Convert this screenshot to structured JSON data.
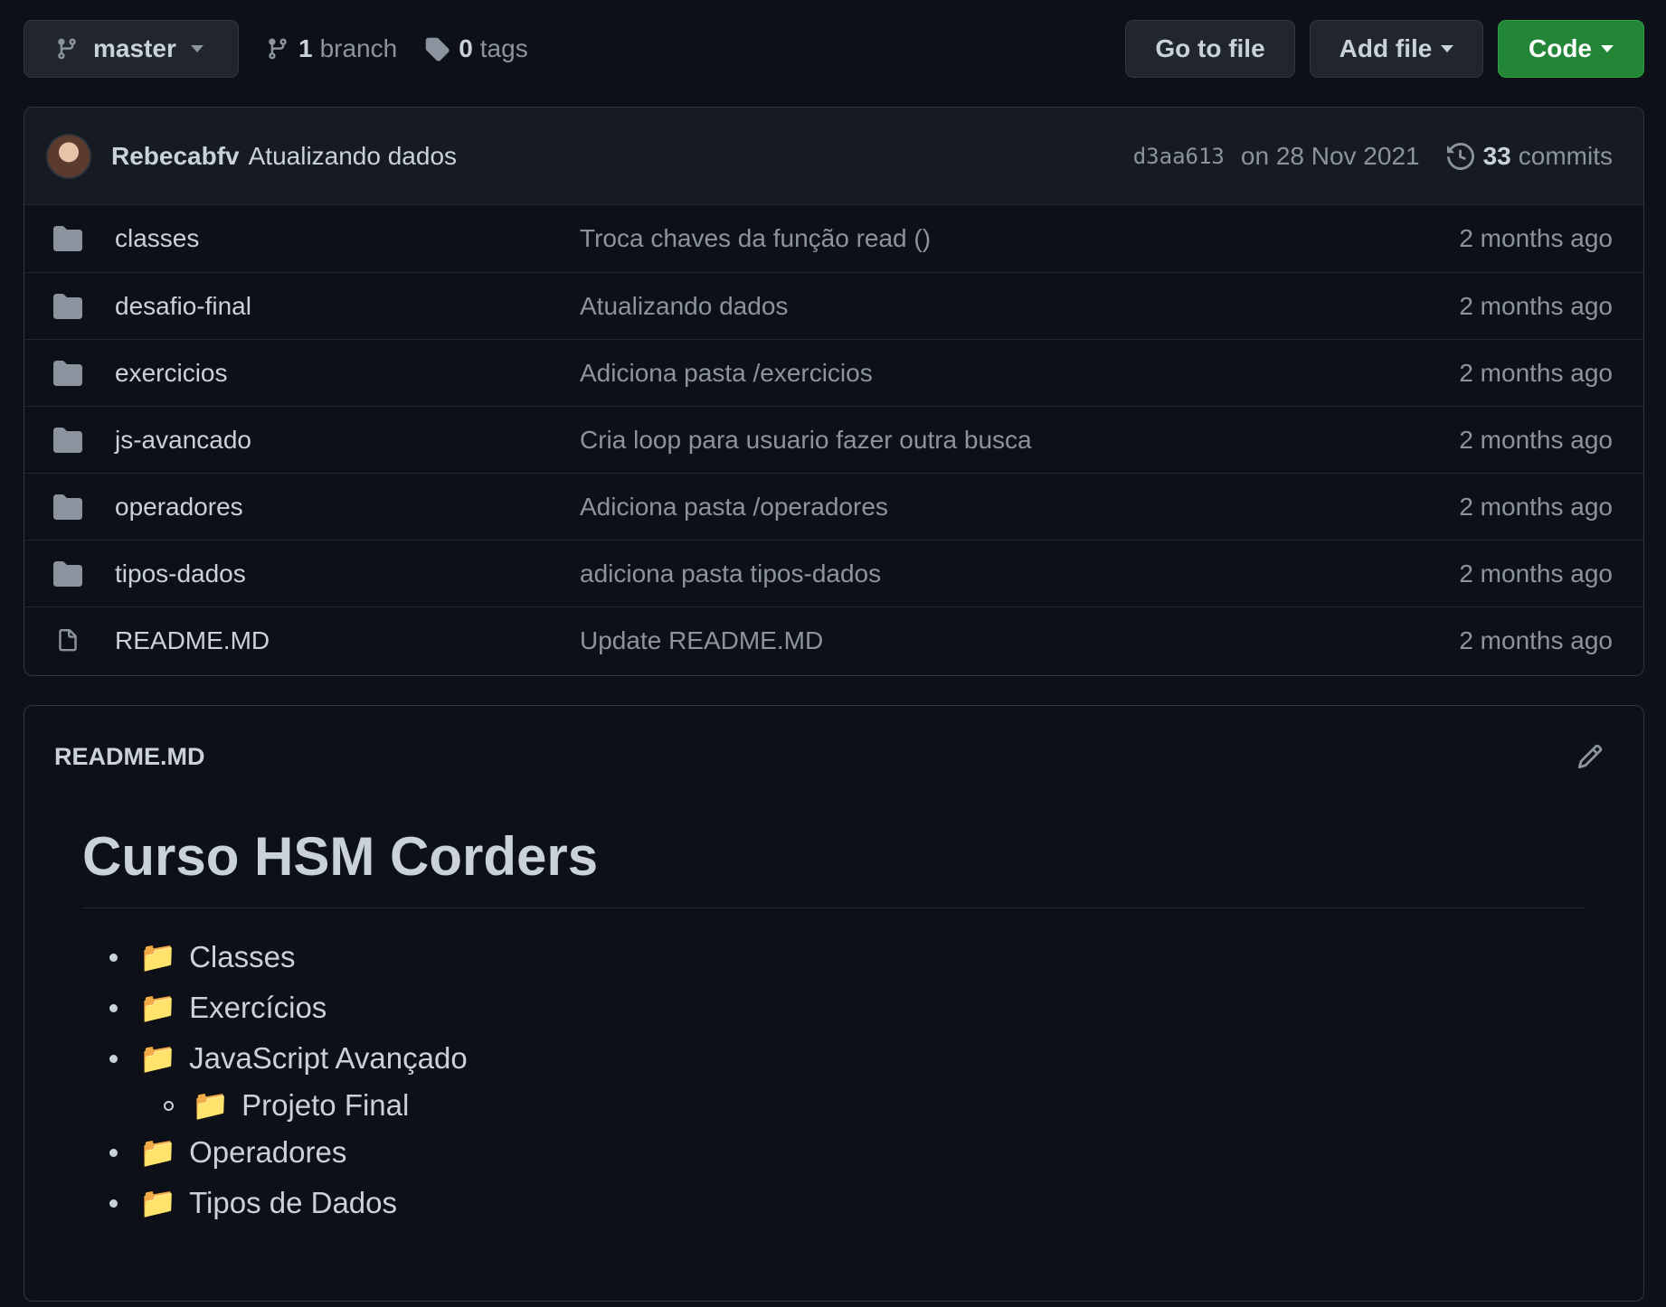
{
  "topbar": {
    "branch_label": "master",
    "branch_count": "1",
    "branch_word": "branch",
    "tag_count": "0",
    "tag_word": "tags",
    "go_to_file": "Go to file",
    "add_file": "Add file",
    "code": "Code"
  },
  "commit": {
    "author": "Rebecabfv",
    "message": "Atualizando dados",
    "sha": "d3aa613",
    "date": "on 28 Nov 2021",
    "commit_count": "33",
    "commit_word": "commits"
  },
  "files": [
    {
      "name": "classes",
      "type": "folder",
      "message": "Troca chaves da função read ()",
      "age": "2 months ago"
    },
    {
      "name": "desafio-final",
      "type": "folder",
      "message": "Atualizando dados",
      "age": "2 months ago"
    },
    {
      "name": "exercicios",
      "type": "folder",
      "message": "Adiciona pasta /exercicios",
      "age": "2 months ago"
    },
    {
      "name": "js-avancado",
      "type": "folder",
      "message": "Cria loop para usuario fazer outra busca",
      "age": "2 months ago"
    },
    {
      "name": "operadores",
      "type": "folder",
      "message": "Adiciona pasta /operadores",
      "age": "2 months ago"
    },
    {
      "name": "tipos-dados",
      "type": "folder",
      "message": "adiciona pasta tipos-dados",
      "age": "2 months ago"
    },
    {
      "name": "README.MD",
      "type": "file",
      "message": "Update README.MD",
      "age": "2 months ago"
    }
  ],
  "readme": {
    "filename": "README.MD",
    "heading": "Curso HSM Corders",
    "items": [
      {
        "emoji": "📁",
        "text": "Classes"
      },
      {
        "emoji": "📁",
        "text": "Exercícios"
      },
      {
        "emoji": "📁",
        "text": "JavaScript Avançado"
      },
      {
        "emoji": "📁",
        "text": "Projeto Final"
      },
      {
        "emoji": "📁",
        "text": "Operadores"
      },
      {
        "emoji": "📁",
        "text": "Tipos de Dados"
      }
    ]
  },
  "colors": {
    "background": "#0d1117",
    "header_bg": "#161b22",
    "border": "#30363d",
    "code_button": "#238636",
    "text": "#c9d1d9",
    "muted": "#8b949e"
  }
}
